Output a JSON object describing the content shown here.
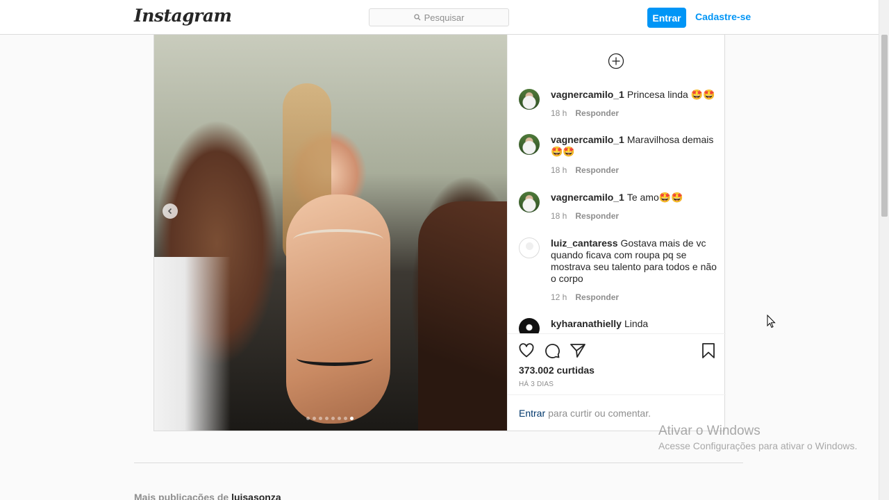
{
  "header": {
    "logo": "Instagram",
    "search_placeholder": "Pesquisar",
    "login_button": "Entrar",
    "signup_link": "Cadastre-se"
  },
  "post": {
    "carousel": {
      "total": 8,
      "active_index": 7
    },
    "comments": [
      {
        "user": "vagnercamilo_1",
        "text": "Princesa linda 🤩🤩",
        "time": "18 h",
        "reply": "Responder",
        "avatar": "photo"
      },
      {
        "user": "vagnercamilo_1",
        "text": "Maravilhosa demais 🤩🤩",
        "time": "18 h",
        "reply": "Responder",
        "avatar": "photo"
      },
      {
        "user": "vagnercamilo_1",
        "text": "Te amo🤩🤩",
        "time": "18 h",
        "reply": "Responder",
        "avatar": "photo"
      },
      {
        "user": "luiz_cantaress",
        "text": "Gostava mais de vc quando ficava com roupa pq se mostrava seu talento para todos e não o corpo",
        "time": "12 h",
        "reply": "Responder",
        "avatar": "blank"
      },
      {
        "user": "kyharanathielly",
        "text": "Linda",
        "time": "",
        "reply": "",
        "avatar": "dark"
      }
    ],
    "likes": "373.002 curtidas",
    "posted": "HÁ 3 DIAS",
    "login_prompt": {
      "link": "Entrar",
      "text": "para curtir ou comentar."
    }
  },
  "more_posts": {
    "prefix": "Mais publicações de",
    "account": "luisasonza"
  },
  "watermark": {
    "title": "Ativar o Windows",
    "subtitle": "Acesse Configurações para ativar o Windows."
  }
}
